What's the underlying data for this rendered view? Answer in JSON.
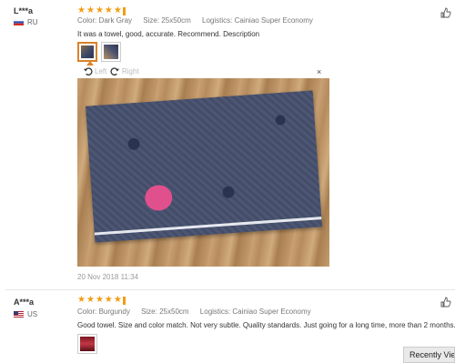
{
  "reviews": [
    {
      "user": "L***a",
      "country": "RU",
      "stars": 5,
      "color_label": "Color:",
      "color": "Dark Gray",
      "size_label": "Size:",
      "size": "25x50cm",
      "logistics_label": "Logistics:",
      "logistics": "Cainiao Super Economy",
      "text": "It was a towel, good, accurate. Recommend. Description",
      "rotate_left": "Left",
      "rotate_right": "Right",
      "close": "×",
      "date": "20 Nov 2018 11:34"
    },
    {
      "user": "A***a",
      "country": "US",
      "stars": 5,
      "color_label": "Color:",
      "color": "Burgundy",
      "size_label": "Size:",
      "size": "25x50cm",
      "logistics_label": "Logistics:",
      "logistics": "Cainiao Super Economy",
      "text": "Good towel. Size and color match. Not very subtle. Quality standards. Just going for a long time, more than 2 months."
    }
  ],
  "recently_viewed": "Recently View",
  "icons": {
    "star": "star-icon",
    "helpful": "thumbs-up-icon",
    "rotate_left": "rotate-left-icon",
    "rotate_right": "rotate-right-icon"
  },
  "colors": {
    "star": "#f39c12",
    "accent": "#d9822b"
  }
}
